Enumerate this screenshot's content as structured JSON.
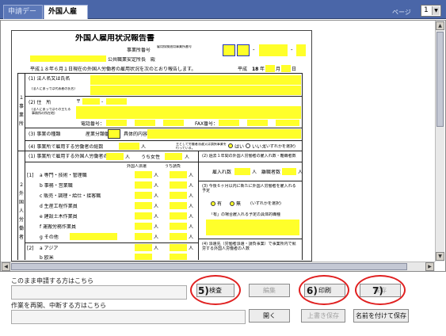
{
  "tabs": [
    {
      "label": "申請データ",
      "active": false
    },
    {
      "label": "外国人雇用状",
      "active": true
    }
  ],
  "pager": {
    "label": "ページ",
    "value": "1"
  },
  "form": {
    "title": "外国人雇用状況報告書",
    "office_number_label": "事業所番号",
    "office_number_note": "雇用保険適用事業所番号",
    "addressee": "公共職業安定所長　殿",
    "intro": "平成１８年６月１日現在の外国人労働者の雇用状況を次のとおり報告します。",
    "date_heisei": "平成",
    "date_year": "18",
    "date_nen": "年",
    "date_month": "月",
    "date_day": "日",
    "section1_chars": [
      "１",
      "事",
      "業",
      "所"
    ],
    "section2_chars": [
      "２",
      "外",
      "国",
      "人",
      "労",
      "働",
      "者"
    ],
    "fields": {
      "name": "(1) 法人名又は氏名",
      "name_sub": "(法人にあっては代表者の氏名)",
      "address": "(2) 住　所",
      "address_sub": "(法人にあってはその主たる事務所の所在地)",
      "postal": "〒",
      "phone": "電話番号：",
      "fax": "FAX番号：",
      "business_type": "(3) 事業の種類",
      "industry_code": "産業分類番号",
      "business_detail": "具体的内容",
      "worker_count": "(4) 事業所で雇用する労働者の総数",
      "worker_unit": "人",
      "employment_note": "主として労働者派遣又は請負事業を行っている。",
      "yes": "はい",
      "no": "いいえ",
      "choice_note": "(いずれかを選択)",
      "count_header": "(1) 事業所で雇用する外国人労働者の人数",
      "of_which_female": "うち女性",
      "dispatch_header": "外国人派遣",
      "contract_header": "うち請負",
      "received_header": "(2) 過去１年間の外国人労働者の雇入れ数・離職者数",
      "hired": "雇入れ数",
      "left": "離職者数",
      "plan_header": "(3) 今後６ヶ月以内に新たに外国人労働者を雇入れる予定",
      "plan_yes": "有",
      "plan_no": "無",
      "plan_detail": "「有」の場合雇入れる予定の具体的職種",
      "dispatch_q": "(4) 派遣先（労働者派遣・請負事業）で事業所内で就労する外国人労働者の人数"
    },
    "categories": [
      {
        "no": "[1]",
        "label": "a 専門・技術・管理職"
      },
      {
        "no": "",
        "label": "b 事務・営業職"
      },
      {
        "no": "",
        "label": "c 販売・調理・給仕・接客職"
      },
      {
        "no": "",
        "label": "d 生産工程作業員"
      },
      {
        "no": "",
        "label": "e 建設土木作業員"
      },
      {
        "no": "",
        "label": "f 運搬労務作業員"
      },
      {
        "no": "",
        "label": "g その他"
      },
      {
        "no": "[2]",
        "label": "a アジア"
      },
      {
        "no": "",
        "label": "b 欧米"
      }
    ]
  },
  "bottom": {
    "submit_label": "このまま申請する方はこちら",
    "resume_label": "作業を再開、中断する方はこちら",
    "buttons_row1": [
      "検査",
      "編集",
      "印刷",
      "保存"
    ],
    "buttons_row2": [
      "開く",
      "上書き保存",
      "名前を付けて保存"
    ]
  },
  "callouts": [
    "5)",
    "6)",
    "7)"
  ]
}
